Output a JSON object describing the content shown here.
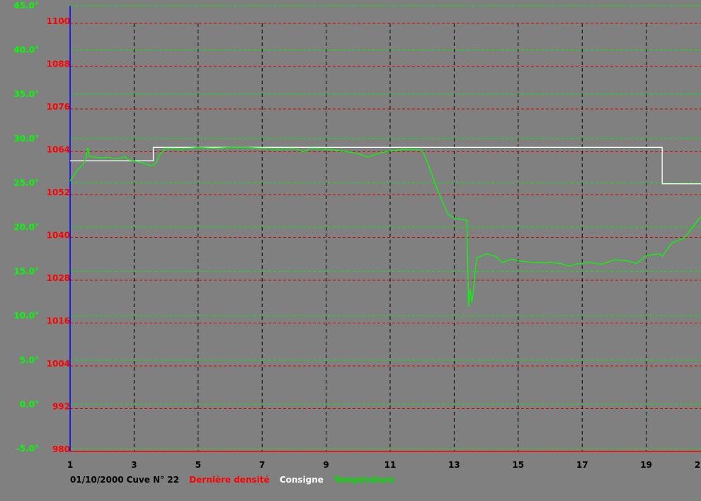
{
  "chart_data": {
    "type": "line",
    "footer": {
      "date": "01/10/2000",
      "tank": "Cuve N° 22"
    },
    "legend": [
      {
        "label": "Dernière densité",
        "color": "#ff0000"
      },
      {
        "label": "Consigne",
        "color": "#ffffff"
      },
      {
        "label": "Température",
        "color": "#00ff00"
      }
    ],
    "x_ticks": [
      "1",
      "3",
      "5",
      "7",
      "9",
      "11",
      "13",
      "15",
      "17",
      "19",
      "2"
    ],
    "x_range": [
      1,
      21
    ],
    "density_axis": {
      "color": "#ff0000",
      "ticks": [
        "1100",
        "1088",
        "1076",
        "1064",
        "1052",
        "1040",
        "1028",
        "1016",
        "1004",
        "992",
        "980"
      ],
      "range": [
        980,
        1100
      ]
    },
    "temperature_axis": {
      "color": "#00ff00",
      "ticks": [
        "45.0°",
        "40.0°",
        "35.0°",
        "30.0°",
        "25.0°",
        "20.0°",
        "15.0°",
        "10.0°",
        "5.0°",
        "0.0°",
        "-5.0°"
      ],
      "range": [
        -5,
        45
      ]
    },
    "grid": true,
    "series": [
      {
        "name": "Consigne",
        "color": "#ffffff",
        "axis": "temperature",
        "step": true,
        "points": [
          [
            1,
            27.5
          ],
          [
            3.6,
            27.5
          ],
          [
            3.6,
            29.0
          ],
          [
            19.5,
            29.0
          ],
          [
            19.5,
            24.9
          ],
          [
            21,
            24.9
          ]
        ]
      },
      {
        "name": "Température",
        "color": "#00ff00",
        "axis": "temperature",
        "points": [
          [
            1,
            25.2
          ],
          [
            1.2,
            26.3
          ],
          [
            1.4,
            27.1
          ],
          [
            1.5,
            27.8
          ],
          [
            1.55,
            29.0
          ],
          [
            1.6,
            28.0
          ],
          [
            1.8,
            27.9
          ],
          [
            2.0,
            27.8
          ],
          [
            2.2,
            27.9
          ],
          [
            2.4,
            27.7
          ],
          [
            2.6,
            27.8
          ],
          [
            2.7,
            28.0
          ],
          [
            2.8,
            27.6
          ],
          [
            3.0,
            27.5
          ],
          [
            3.2,
            27.3
          ],
          [
            3.4,
            27.1
          ],
          [
            3.55,
            26.9
          ],
          [
            3.7,
            27.3
          ],
          [
            3.8,
            28.2
          ],
          [
            4.0,
            28.9
          ],
          [
            4.5,
            28.8
          ],
          [
            5.0,
            29.0
          ],
          [
            5.5,
            28.9
          ],
          [
            6.0,
            29.0
          ],
          [
            6.5,
            29.0
          ],
          [
            7.0,
            28.9
          ],
          [
            7.5,
            28.8
          ],
          [
            8.0,
            28.9
          ],
          [
            8.3,
            28.5
          ],
          [
            8.5,
            28.9
          ],
          [
            9.0,
            28.8
          ],
          [
            9.5,
            28.6
          ],
          [
            10.0,
            28.3
          ],
          [
            10.3,
            27.9
          ],
          [
            10.6,
            28.3
          ],
          [
            11.0,
            28.6
          ],
          [
            11.5,
            28.8
          ],
          [
            12.0,
            28.7
          ],
          [
            12.2,
            27.0
          ],
          [
            12.5,
            24.0
          ],
          [
            12.8,
            21.5
          ],
          [
            13.0,
            21.0
          ],
          [
            13.4,
            20.8
          ],
          [
            13.45,
            11.0
          ],
          [
            13.5,
            13.0
          ],
          [
            13.55,
            11.5
          ],
          [
            13.6,
            12.8
          ],
          [
            13.7,
            16.5
          ],
          [
            14.0,
            17.0
          ],
          [
            14.3,
            16.7
          ],
          [
            14.5,
            16.0
          ],
          [
            14.8,
            16.4
          ],
          [
            15.0,
            16.2
          ],
          [
            15.5,
            16.0
          ],
          [
            16.0,
            16.0
          ],
          [
            16.3,
            15.9
          ],
          [
            16.6,
            15.6
          ],
          [
            16.9,
            15.9
          ],
          [
            17.3,
            16.0
          ],
          [
            17.6,
            15.8
          ],
          [
            18.0,
            16.3
          ],
          [
            18.4,
            16.2
          ],
          [
            18.7,
            15.9
          ],
          [
            19.0,
            16.8
          ],
          [
            19.4,
            17.0
          ],
          [
            19.5,
            16.7
          ],
          [
            19.8,
            18.2
          ],
          [
            20.2,
            18.8
          ],
          [
            20.6,
            20.7
          ],
          [
            20.9,
            21.9
          ],
          [
            21,
            22.0
          ]
        ]
      }
    ]
  }
}
